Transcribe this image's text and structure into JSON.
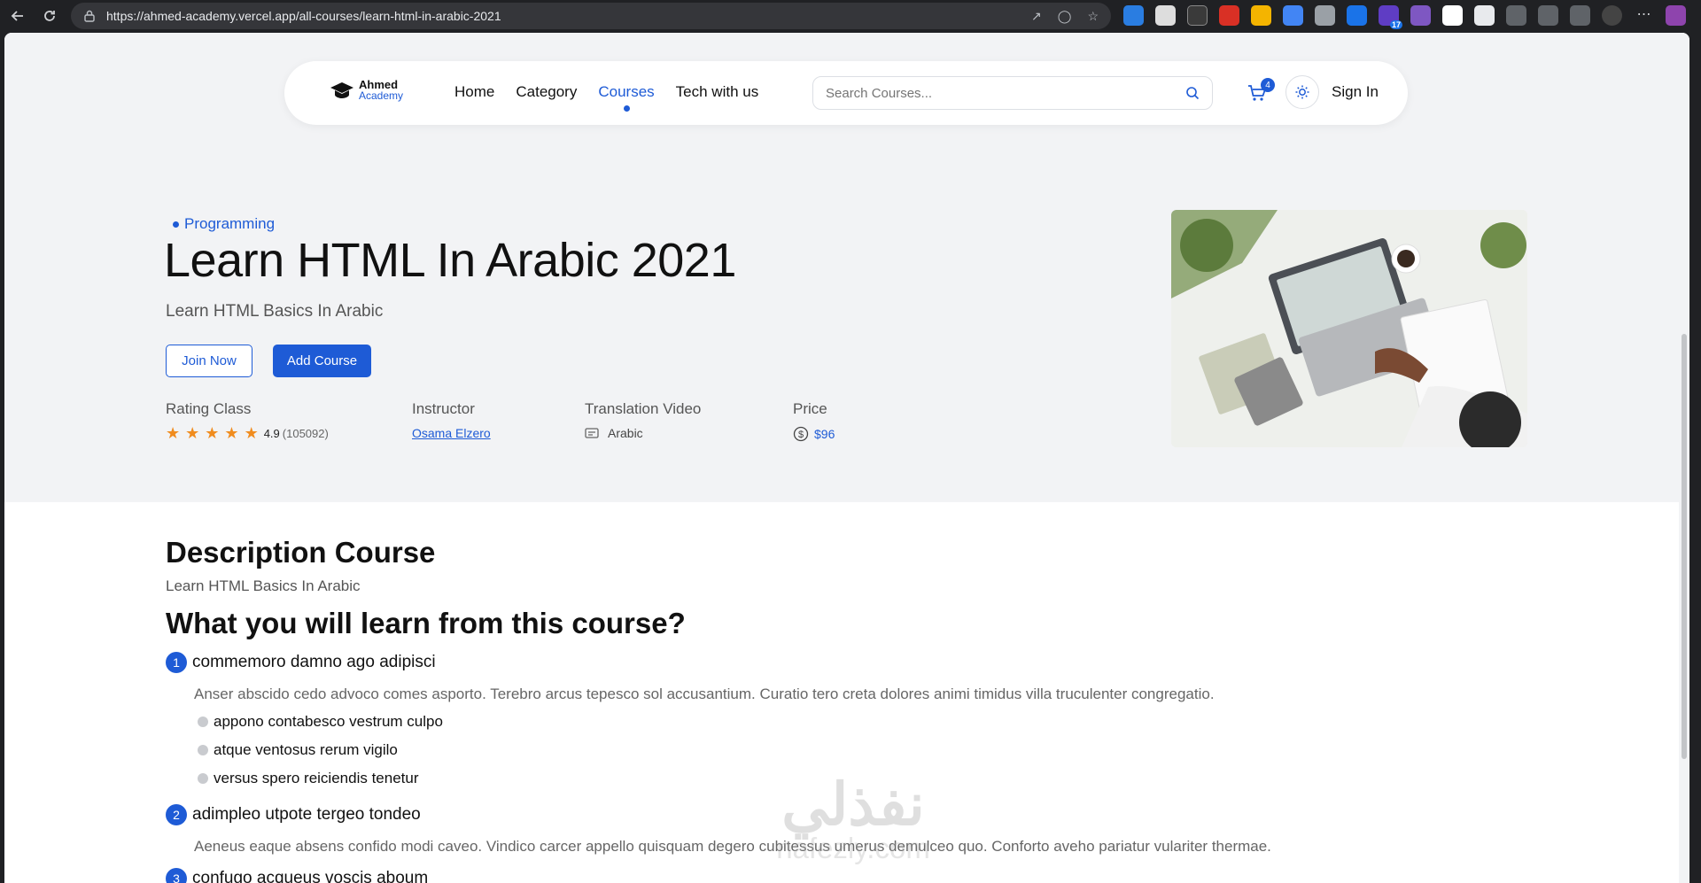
{
  "browser": {
    "url": "https://ahmed-academy.vercel.app/all-courses/learn-html-in-arabic-2021",
    "extension_badge": "17"
  },
  "navbar": {
    "logo_line1": "Ahmed",
    "logo_line2": "Academy",
    "menu": [
      "Home",
      "Category",
      "Courses",
      "Tech with us"
    ],
    "active_menu": "Courses",
    "search_placeholder": "Search Courses...",
    "cart_count": "4",
    "sign_in": "Sign In"
  },
  "hero": {
    "category": "Programming",
    "title": "Learn HTML In Arabic 2021",
    "subtitle": "Learn HTML Basics In Arabic",
    "join_label": "Join Now",
    "add_label": "Add Course",
    "rating_label": "Rating Class",
    "rating_value": "4.9",
    "rating_count": "(105092)",
    "rating_stars": 5,
    "instructor_label": "Instructor",
    "instructor_name": "Osama Elzero",
    "translation_label": "Translation Video",
    "translation_value": "Arabic",
    "price_label": "Price",
    "price_value": "$96"
  },
  "content": {
    "description_title": "Description Course",
    "description_text": "Learn HTML Basics In Arabic",
    "learn_title": "What you will learn from this course?",
    "sections": [
      {
        "number": "1",
        "title": "commemoro damno ago adipisci",
        "text": "Anser abscido cedo advoco comes asporto. Terebro arcus tepesco sol accusantium. Curatio tero creta dolores animi timidus villa truculenter congregatio.",
        "bullets": [
          "appono contabesco vestrum culpo",
          "atque ventosus rerum vigilo",
          "versus spero reiciendis tenetur"
        ]
      },
      {
        "number": "2",
        "title": "adimpleo utpote tergeo tondeo",
        "text": "Aeneus eaque absens confido modi caveo. Vindico carcer appello quisquam degero cubitessus umerus demulceo quo. Conforto aveho pariatur vulariter thermae."
      },
      {
        "number": "3",
        "title": "confugo acqueus voscis aboum"
      }
    ]
  },
  "watermark": {
    "ar": "نفذلي",
    "en": "nafezly.com"
  },
  "colors": {
    "accent": "#1e5bd6",
    "star": "#f08c1f"
  }
}
